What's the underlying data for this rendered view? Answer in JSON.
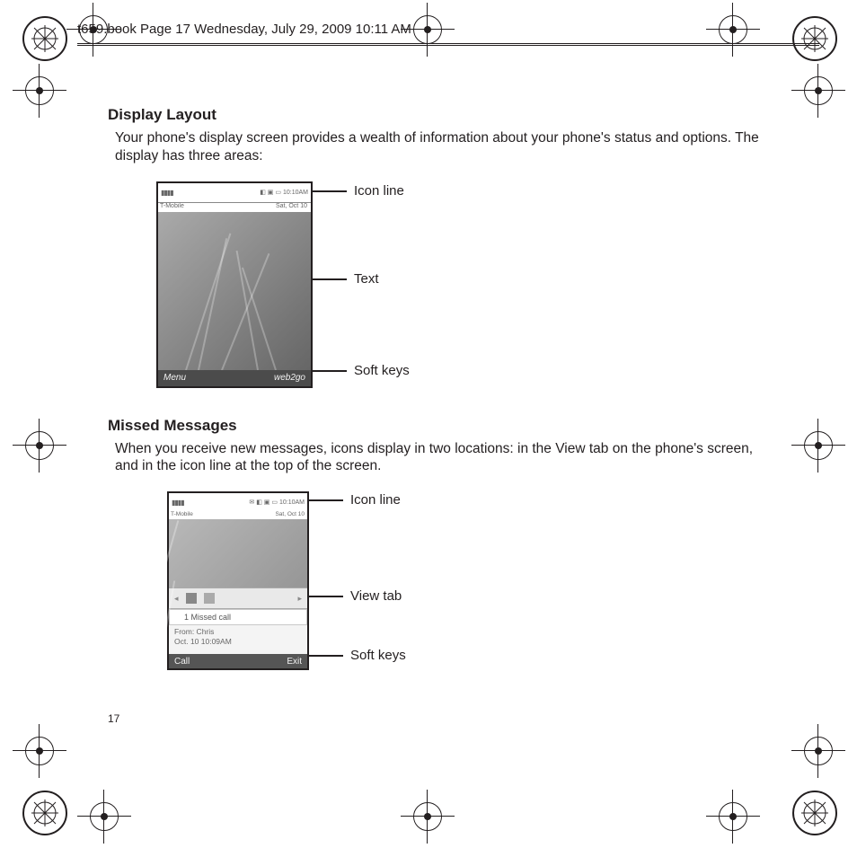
{
  "header": "t659.book  Page 17  Wednesday, July 29, 2009  10:11 AM",
  "page_number": "17",
  "section1": {
    "title": "Display Layout",
    "body": "Your phone's display screen provides a wealth of information about your phone's status and options. The display has three areas:"
  },
  "figure1": {
    "carrier": "T-Mobile",
    "time": "10:10AM",
    "date": "Sat, Oct 10",
    "soft_left": "Menu",
    "soft_right": "web2go",
    "labels": {
      "top": "Icon line",
      "mid": "Text",
      "bot": "Soft keys"
    }
  },
  "section2": {
    "title": "Missed Messages",
    "body": "When you receive new messages, icons display in two locations: in the View tab on the phone's screen, and in the icon line at the top of the screen."
  },
  "figure2": {
    "carrier": "T-Mobile",
    "time": "10:10AM",
    "date": "Sat, Oct 10",
    "missed": "1  Missed call",
    "from": "From: Chris",
    "when": "Oct. 10 10:09AM",
    "soft_left": "Call",
    "soft_right": "Exit",
    "labels": {
      "top": "Icon line",
      "mid": "View tab",
      "bot": "Soft keys"
    }
  }
}
